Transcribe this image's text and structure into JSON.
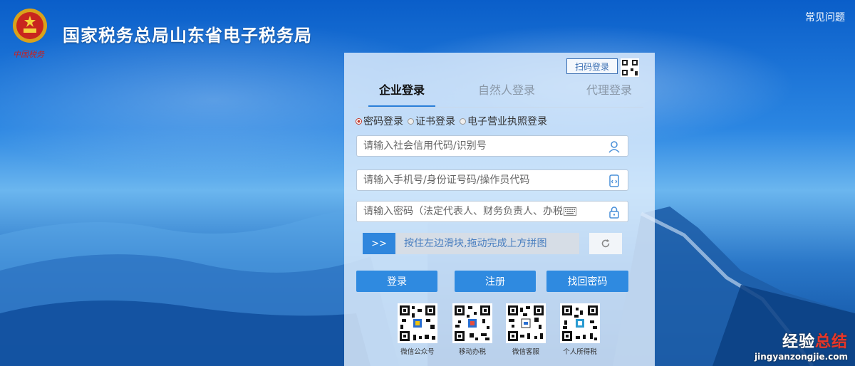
{
  "header": {
    "title": "国家税务总局山东省电子税务局",
    "slogan": "中国税务",
    "faq_link": "常见问题"
  },
  "login": {
    "scan_label": "扫码登录",
    "tabs": [
      {
        "label": "企业登录",
        "active": true
      },
      {
        "label": "自然人登录",
        "active": false
      },
      {
        "label": "代理登录",
        "active": false
      }
    ],
    "methods": [
      {
        "label": "密码登录",
        "selected": true
      },
      {
        "label": "证书登录",
        "selected": false
      },
      {
        "label": "电子营业执照登录",
        "selected": false
      }
    ],
    "fields": {
      "credit_code_placeholder": "请输入社会信用代码/识别号",
      "phone_placeholder": "请输入手机号/身份证号码/操作员代码",
      "password_placeholder": "请输入密码（法定代表人、财务负责人、办税"
    },
    "slider": {
      "handle": ">>",
      "hint": "按住左边滑块,拖动完成上方拼图"
    },
    "buttons": {
      "login": "登录",
      "register": "注册",
      "recover": "找回密码"
    },
    "qr_codes": [
      {
        "caption": "微信公众号"
      },
      {
        "caption": "移动办税"
      },
      {
        "caption": "微信客服"
      },
      {
        "caption": "个人所得税"
      }
    ]
  },
  "watermark": {
    "brand_part1": "经验",
    "brand_part2": "总结",
    "url": "jingyanzongjie.com"
  },
  "colors": {
    "accent": "#2f8ae0",
    "brand_red": "#c0392b"
  }
}
